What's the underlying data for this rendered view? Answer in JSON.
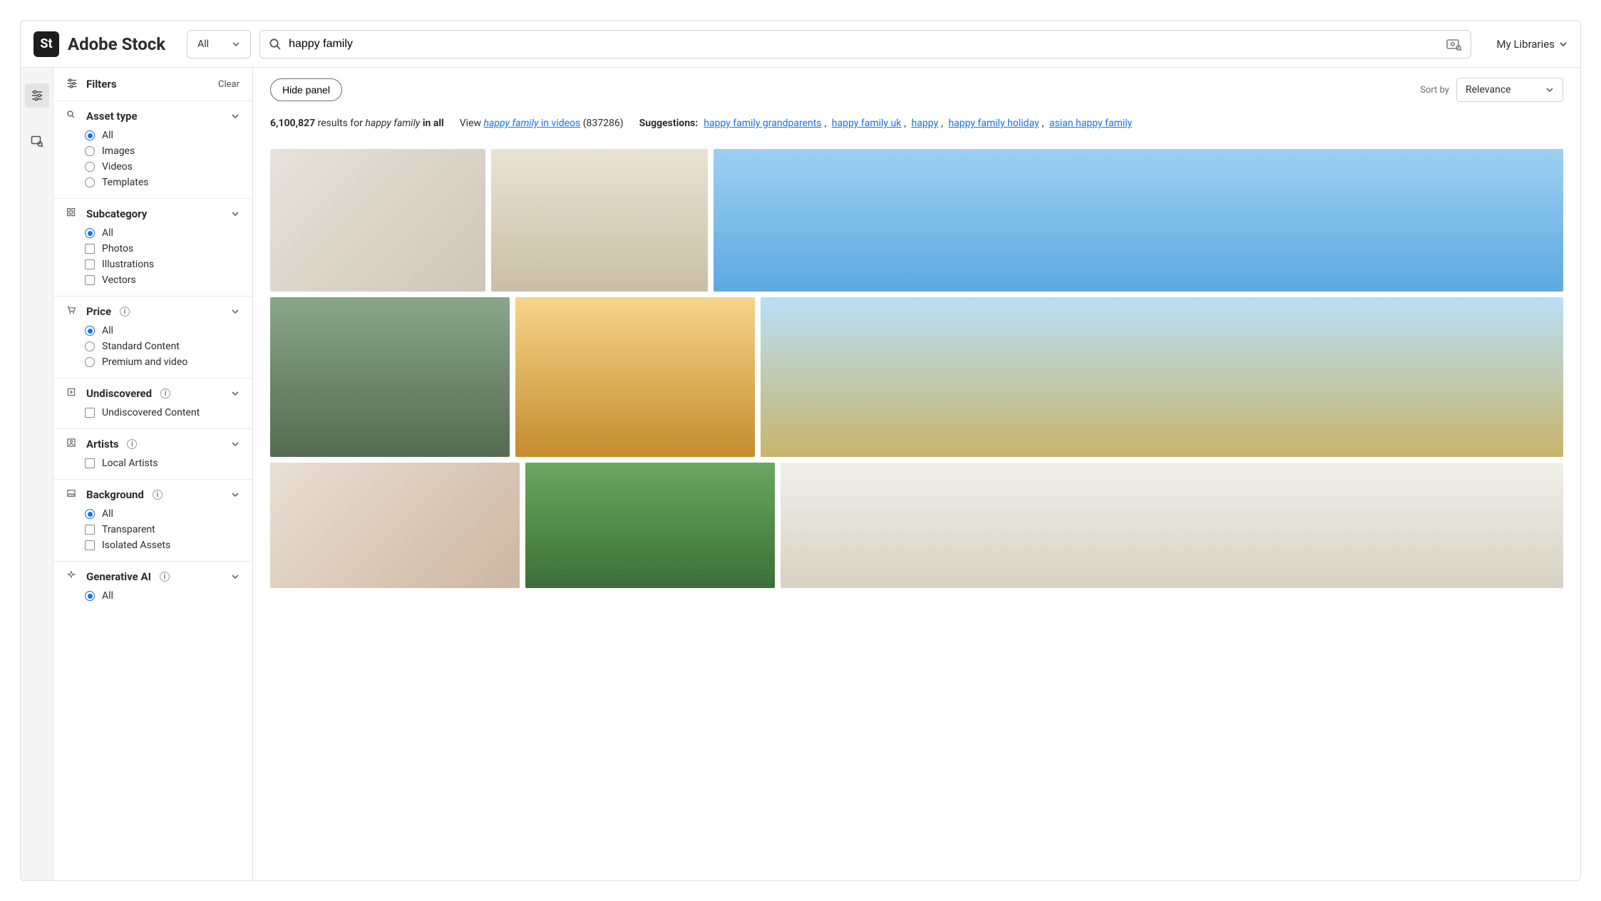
{
  "brand": {
    "badge": "St",
    "name": "Adobe Stock"
  },
  "header": {
    "category_selected": "All",
    "search_value": "happy family",
    "my_libraries": "My Libraries"
  },
  "filters_panel": {
    "title": "Filters",
    "clear": "Clear"
  },
  "sections": {
    "asset_type": {
      "title": "Asset type",
      "opts": {
        "all": "All",
        "images": "Images",
        "videos": "Videos",
        "templates": "Templates"
      }
    },
    "subcategory": {
      "title": "Subcategory",
      "opts": {
        "all": "All",
        "photos": "Photos",
        "illustrations": "Illustrations",
        "vectors": "Vectors"
      }
    },
    "price": {
      "title": "Price",
      "opts": {
        "all": "All",
        "standard": "Standard Content",
        "premium": "Premium and video"
      }
    },
    "undiscovered": {
      "title": "Undiscovered",
      "opts": {
        "undiscovered": "Undiscovered Content"
      }
    },
    "artists": {
      "title": "Artists",
      "opts": {
        "local": "Local Artists"
      }
    },
    "background": {
      "title": "Background",
      "opts": {
        "all": "All",
        "transparent": "Transparent",
        "isolated": "Isolated Assets"
      }
    },
    "genai": {
      "title": "Generative AI",
      "opts": {
        "all": "All"
      }
    }
  },
  "main": {
    "hide_panel": "Hide panel",
    "sort_by_label": "Sort by",
    "sort_value": "Relevance",
    "results_count": "6,100,827",
    "results_text_1": "results for",
    "results_query": "happy family",
    "results_text_2": "in all",
    "view_label": "View",
    "view_link_em": "happy family",
    "view_link_rest": "in videos",
    "view_count": "(837286)",
    "suggestions_label": "Suggestions:",
    "suggestions": [
      "happy family grandparents",
      "happy family uk",
      "happy",
      "happy family holiday",
      "asian happy family"
    ]
  }
}
